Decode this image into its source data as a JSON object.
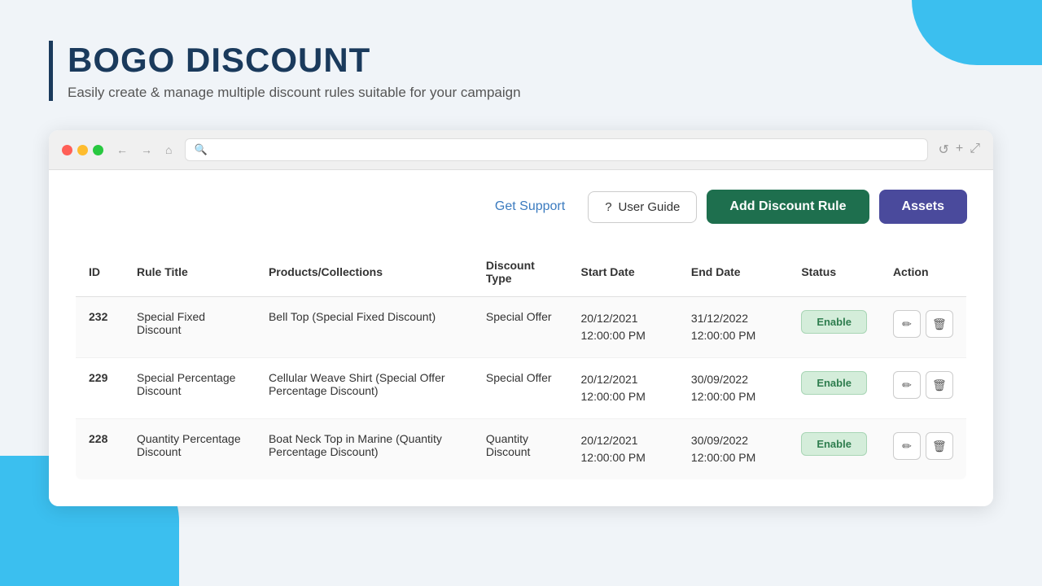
{
  "page": {
    "title": "BOGO DISCOUNT",
    "subtitle": "Easily create & manage multiple discount rules suitable for your campaign"
  },
  "toolbar": {
    "get_support_label": "Get Support",
    "user_guide_label": "User Guide",
    "add_discount_label": "Add Discount Rule",
    "assets_label": "Assets"
  },
  "table": {
    "headers": {
      "id": "ID",
      "rule_title": "Rule Title",
      "products_collections": "Products/Collections",
      "discount_type": "Discount Type",
      "start_date": "Start Date",
      "end_date": "End Date",
      "status": "Status",
      "action": "Action"
    },
    "rows": [
      {
        "id": "232",
        "rule_title": "Special Fixed Discount",
        "products_collections": "Bell Top (Special Fixed Discount)",
        "discount_type": "Special Offer",
        "start_date": "20/12/2021\n12:00:00 PM",
        "end_date": "31/12/2022\n12:00:00 PM",
        "status": "Enable"
      },
      {
        "id": "229",
        "rule_title": "Special Percentage Discount",
        "products_collections": "Cellular Weave Shirt (Special Offer Percentage Discount)",
        "discount_type": "Special Offer",
        "start_date": "20/12/2021\n12:00:00 PM",
        "end_date": "30/09/2022\n12:00:00 PM",
        "status": "Enable"
      },
      {
        "id": "228",
        "rule_title": "Quantity Percentage Discount",
        "products_collections": "Boat Neck Top in Marine (Quantity Percentage Discount)",
        "discount_type": "Quantity Discount",
        "start_date": "20/12/2021\n12:00:00 PM",
        "end_date": "30/09/2022\n12:00:00 PM",
        "status": "Enable"
      }
    ]
  },
  "browser": {
    "dots": [
      "red",
      "yellow",
      "green"
    ]
  },
  "icons": {
    "question": "?",
    "edit": "✏",
    "delete": "🗑",
    "back": "←",
    "forward": "→",
    "home": "⌂",
    "search": "🔍",
    "refresh": "↺",
    "new_tab": "+",
    "expand": "⤢"
  },
  "colors": {
    "brand_dark": "#1a3a5c",
    "accent_blue": "#3bbfef",
    "accent_orange": "#e8512a",
    "green_button": "#1e6f4e",
    "purple_button": "#4a4a9c",
    "support_link": "#3b7bbf"
  }
}
